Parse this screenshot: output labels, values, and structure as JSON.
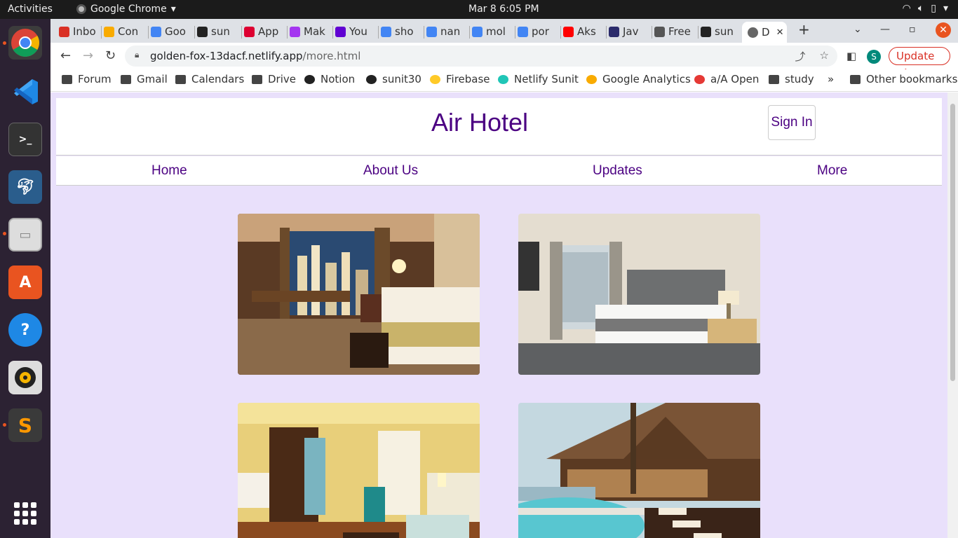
{
  "os": {
    "activities": "Activities",
    "app_name": "Google Chrome",
    "clock": "Mar 8  6:05 PM"
  },
  "browser": {
    "tabs": [
      {
        "label": "Inbo",
        "icon": "gmail-icon",
        "color": "#d93025"
      },
      {
        "label": "Con",
        "icon": "warning-icon",
        "color": "#f9ab00"
      },
      {
        "label": "Goo",
        "icon": "docs-icon",
        "color": "#4285f4"
      },
      {
        "label": "sun",
        "icon": "github-icon",
        "color": "#222222"
      },
      {
        "label": "App",
        "icon": "angular-icon",
        "color": "#dd0031"
      },
      {
        "label": "Mak",
        "icon": "udemy-icon",
        "color": "#a435f0"
      },
      {
        "label": "You",
        "icon": "yahoo-icon",
        "color": "#6001d2"
      },
      {
        "label": "sho",
        "icon": "google-icon",
        "color": "#4285f4"
      },
      {
        "label": "nan",
        "icon": "google-icon",
        "color": "#4285f4"
      },
      {
        "label": "mol",
        "icon": "google-icon",
        "color": "#4285f4"
      },
      {
        "label": "por",
        "icon": "google-icon",
        "color": "#4285f4"
      },
      {
        "label": "Aks",
        "icon": "youtube-icon",
        "color": "#ff0000"
      },
      {
        "label": "Jav",
        "icon": "appwrite-icon",
        "color": "#2b2b6b"
      },
      {
        "label": "Free",
        "icon": "globe-icon",
        "color": "#555555"
      },
      {
        "label": "sun",
        "icon": "github-icon",
        "color": "#222222"
      }
    ],
    "active_tab": {
      "label": "D",
      "icon": "globe-icon"
    },
    "url_host": "golden-fox-13dacf.netlify.app",
    "url_path": "/more.html",
    "profile_initial": "S",
    "update_label": "Update",
    "bookmarks": [
      {
        "label": "Forum",
        "icon": "folder-icon"
      },
      {
        "label": "Gmail",
        "icon": "folder-icon"
      },
      {
        "label": "Calendars",
        "icon": "folder-icon"
      },
      {
        "label": "Drive",
        "icon": "folder-icon"
      },
      {
        "label": "Notion",
        "icon": "notion-icon"
      },
      {
        "label": "sunit30",
        "icon": "github-icon"
      },
      {
        "label": "Firebase",
        "icon": "firebase-icon"
      },
      {
        "label": "Netlify Sunit",
        "icon": "netlify-icon"
      },
      {
        "label": "Google Analytics",
        "icon": "analytics-icon"
      },
      {
        "label": "a/A Open",
        "icon": "appacademy-icon"
      },
      {
        "label": "study",
        "icon": "folder-icon"
      }
    ],
    "overflow": "»",
    "other_bookmarks": "Other bookmarks"
  },
  "site": {
    "title": "Air Hotel",
    "sign_in": "Sign In",
    "nav": [
      "Home",
      "About Us",
      "Updates",
      "More"
    ],
    "photos": [
      "hotel-room-city-view",
      "hotel-room-grey-headboard",
      "hotel-suite-living-area",
      "resort-pool-lodge"
    ]
  },
  "colors": {
    "brand": "#4b0082",
    "page_bg": "#e9e0fb"
  }
}
